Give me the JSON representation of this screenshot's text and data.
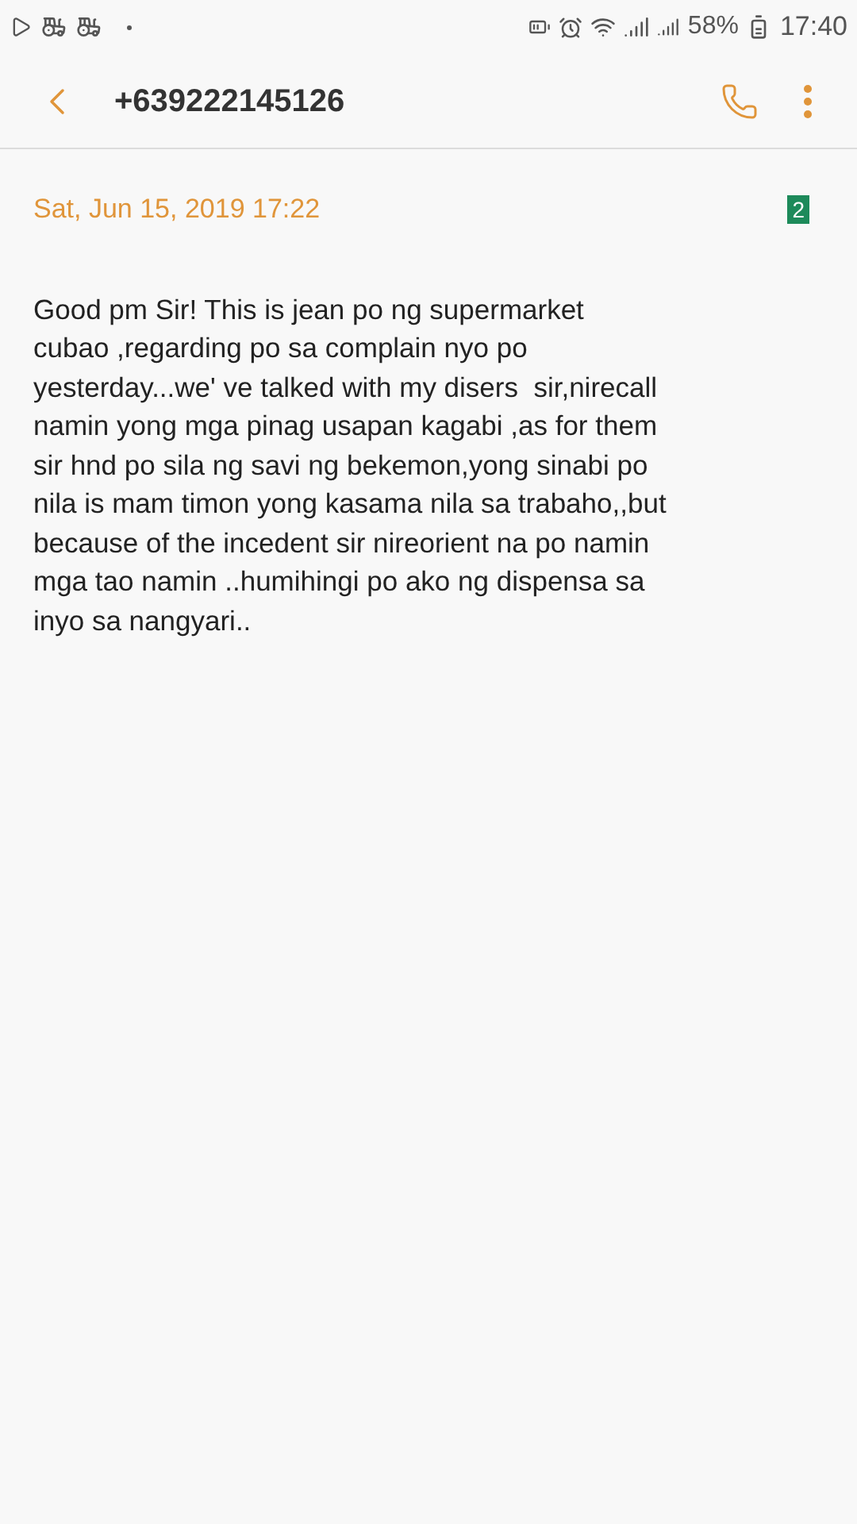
{
  "status_bar": {
    "battery_text": "58%",
    "time": "17:40"
  },
  "header": {
    "title": "+639222145126"
  },
  "message": {
    "date": "Sat, Jun 15, 2019 17:22",
    "sim_badge": "2",
    "text": "Good pm Sir! This is jean po ng supermarket\ncubao ,regarding po sa complain nyo po\nyesterday...we' ve talked with my disers  sir,nirecall\nnamin yong mga pinag usapan kagabi ,as for them\nsir hnd po sila ng savi ng bekemon,yong sinabi po\nnila is mam timon yong kasama nila sa trabaho,,but\nbecause of the incedent sir nireorient na po namin\nmga tao namin ..humihingi po ako ng dispensa sa\ninyo sa nangyari.."
  }
}
